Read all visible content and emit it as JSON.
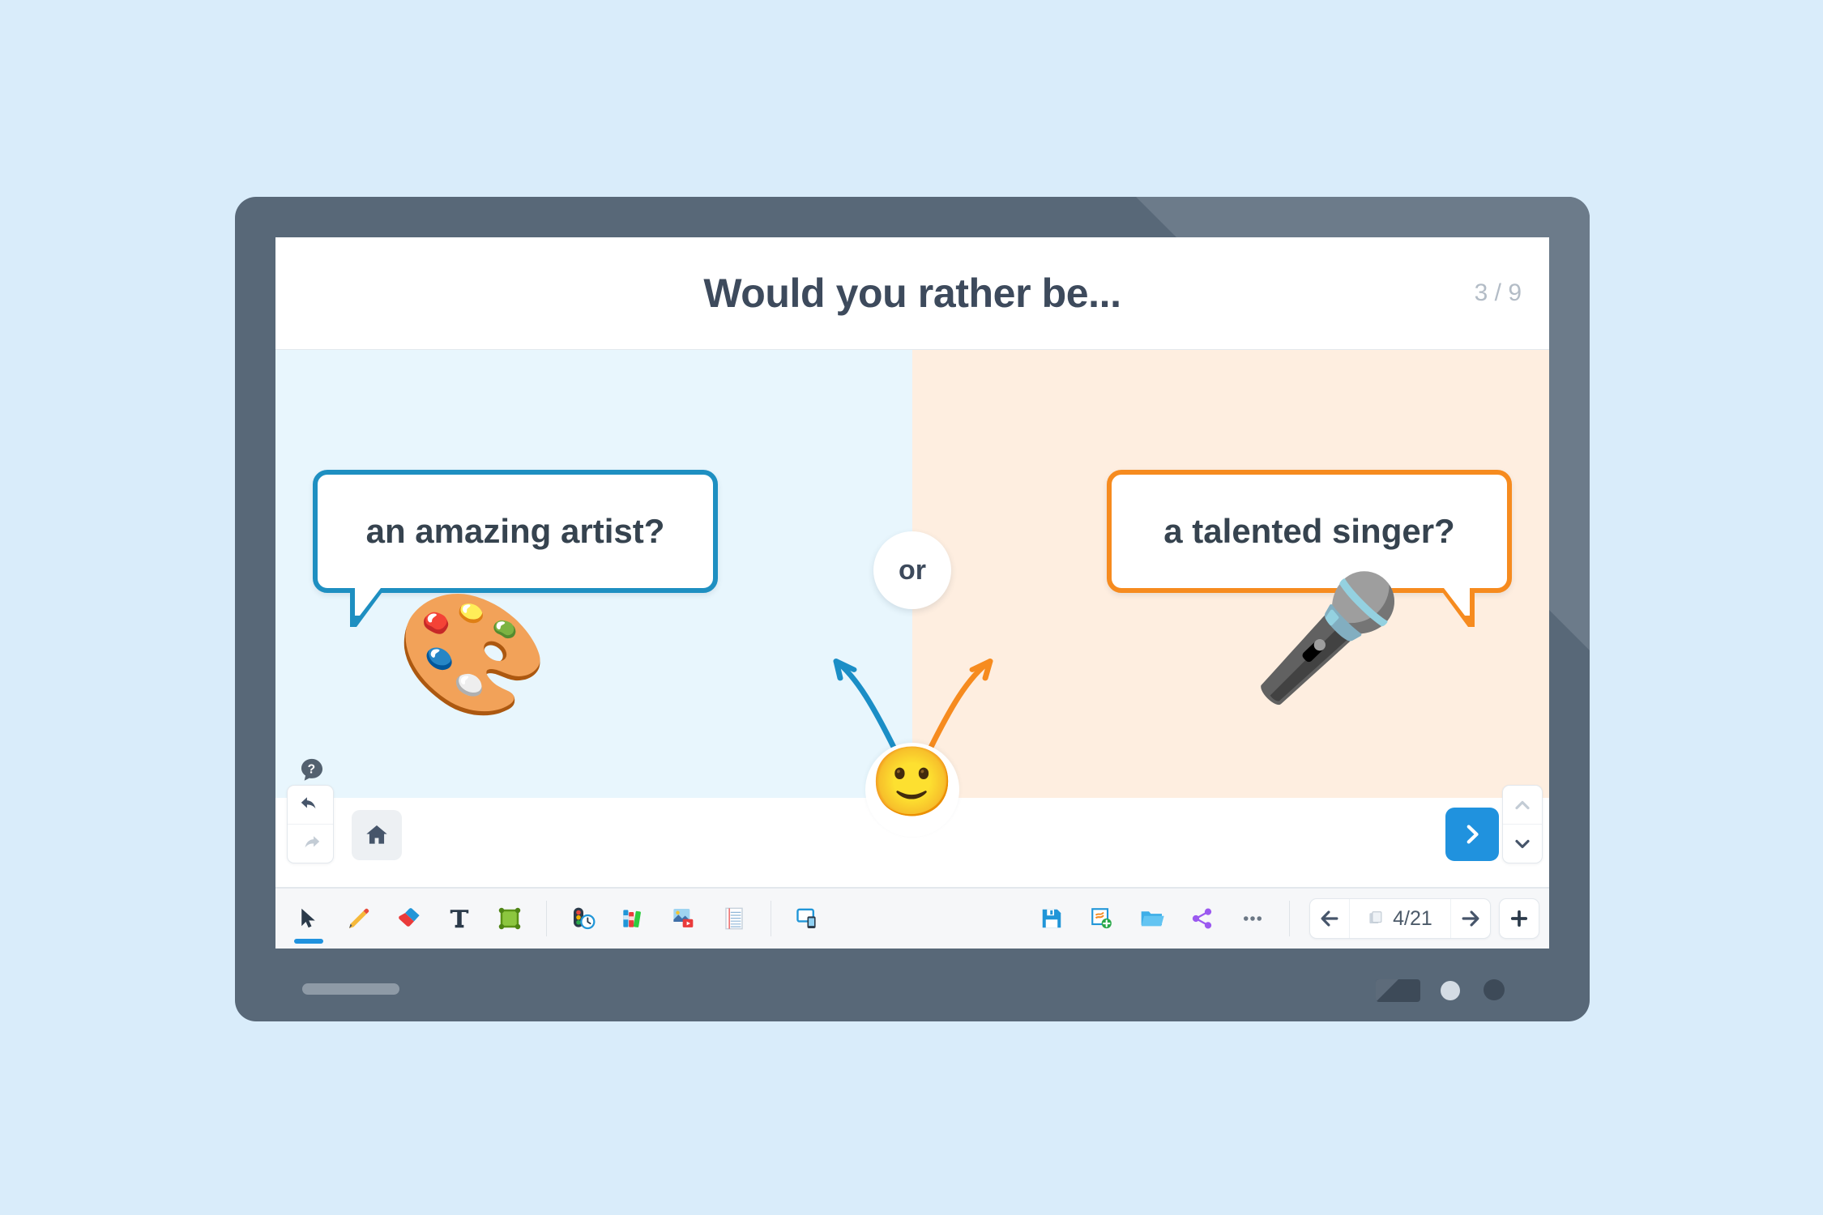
{
  "theme": {
    "page_background": "#d9ecfa",
    "frame_color": "#586878",
    "left_panel_color": "#e8f6fd",
    "right_panel_color": "#feeee0",
    "left_accent": "#1e8fc1",
    "right_accent": "#f68b1f",
    "primary_button": "#2092de",
    "title_color": "#3d4a5c"
  },
  "header": {
    "title": "Would you rather be...",
    "counter": "3 / 9"
  },
  "slide": {
    "or_label": "or",
    "left_option": {
      "text": "an amazing artist?",
      "emoji": "🎨",
      "emoji_name": "artist-palette-emoji"
    },
    "right_option": {
      "text": "a talented singer?",
      "emoji": "🎤",
      "emoji_name": "microphone-emoji"
    },
    "avatar_emoji": "🙂",
    "help_icon_name": "help-question-bubble-icon"
  },
  "action_bar": {
    "undo_label": "Undo",
    "redo_label": "Redo",
    "home_label": "Home",
    "next_label": "Next",
    "scroll_up_label": "Scroll up",
    "scroll_down_label": "Scroll down"
  },
  "toolbar": {
    "tools": [
      {
        "name": "select-tool",
        "label": "Select",
        "icon": "cursor-arrow-icon",
        "active": true
      },
      {
        "name": "pen-tool",
        "label": "Pen",
        "icon": "pencil-icon",
        "emoji": "✏️",
        "active": false
      },
      {
        "name": "eraser-tool",
        "label": "Eraser",
        "icon": "eraser-icon",
        "active": false
      },
      {
        "name": "text-tool",
        "label": "Text",
        "icon": "text-t-icon",
        "active": false
      },
      {
        "name": "shape-tool",
        "label": "Shape",
        "icon": "shape-frame-icon",
        "active": false
      }
    ],
    "content_tools": [
      {
        "name": "classroom-tools",
        "label": "Classroom tools",
        "icon": "traffic-light-timer-icon"
      },
      {
        "name": "library-tool",
        "label": "Library",
        "icon": "books-icon",
        "emoji": "📚"
      },
      {
        "name": "media-tool",
        "label": "Media",
        "icon": "image-video-icon"
      },
      {
        "name": "paper-tool",
        "label": "Paper",
        "icon": "lined-paper-icon",
        "emoji": "📝"
      }
    ],
    "device_tools": [
      {
        "name": "cast-tool",
        "label": "Cast to device",
        "icon": "screen-share-icon"
      }
    ],
    "file_actions": [
      {
        "name": "save-button",
        "label": "Save",
        "icon": "floppy-disk-icon",
        "emoji": "💾"
      },
      {
        "name": "new-button",
        "label": "New lesson",
        "icon": "new-document-icon"
      },
      {
        "name": "open-button",
        "label": "Open",
        "icon": "open-folder-icon",
        "emoji": "📂"
      },
      {
        "name": "share-button",
        "label": "Share",
        "icon": "share-nodes-icon"
      },
      {
        "name": "more-button",
        "label": "More options",
        "icon": "ellipsis-icon"
      }
    ],
    "page_nav": {
      "prev_label": "Previous page",
      "next_label": "Next page",
      "pages_icon": "stacked-pages-icon",
      "indicator": "4/21",
      "current_page": 4,
      "total_pages": 21,
      "add_label": "Add page"
    }
  }
}
